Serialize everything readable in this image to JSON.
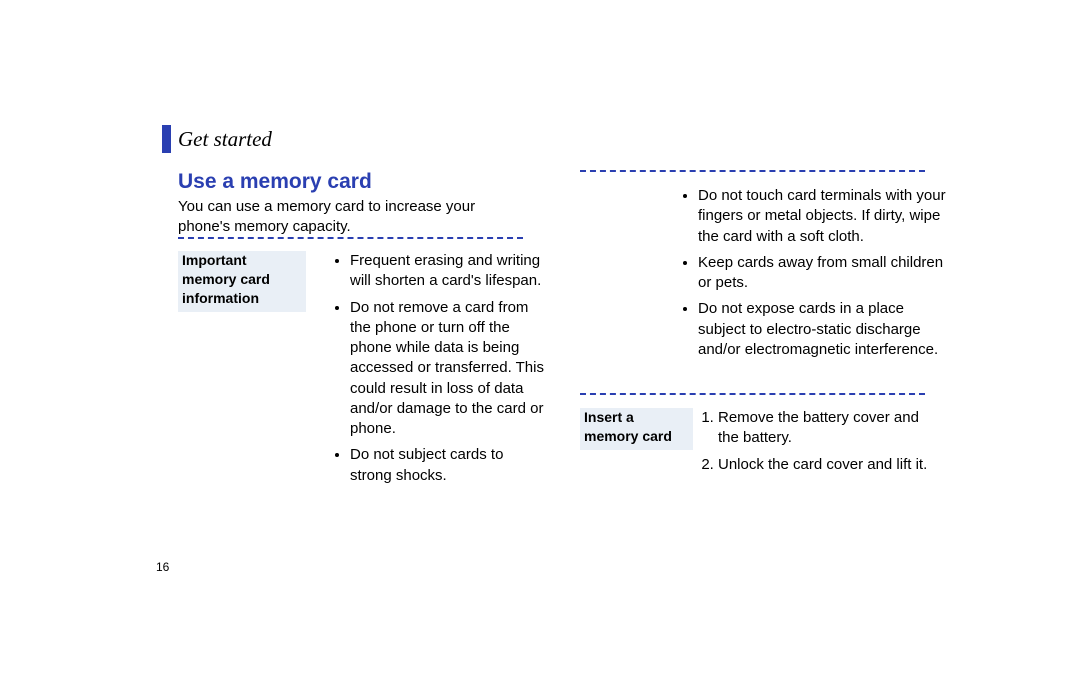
{
  "header": {
    "section": "Get started",
    "title": "Use a memory card",
    "intro": "You can use a memory card to increase your phone's memory capacity."
  },
  "left": {
    "box_line1": "Important",
    "box_line2": "memory card",
    "box_line3": "information",
    "items": [
      "Frequent erasing and writing will shorten a card's lifespan.",
      "Do not remove a card from the phone or turn off the phone while data is being accessed or transferred. This could result in loss of data and/or damage to the card or phone.",
      "Do not subject cards to strong shocks."
    ]
  },
  "right_upper": {
    "items": [
      "Do not touch card terminals with your fingers or metal objects. If dirty, wipe the card with a soft cloth.",
      "Keep cards away from small children or pets.",
      "Do not expose cards in a place subject to electro-static discharge and/or electromagnetic interference."
    ]
  },
  "right_lower": {
    "box_line1": "Insert a",
    "box_line2": "memory card",
    "items": [
      "Remove the battery cover and the battery.",
      "Unlock the card cover and lift it."
    ]
  },
  "page_number": "16"
}
